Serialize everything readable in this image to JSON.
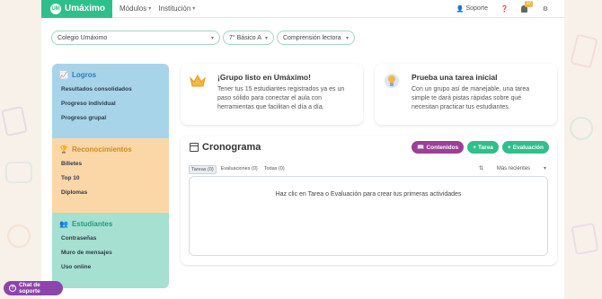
{
  "header": {
    "brand": "Umáximo",
    "brand_logo_text": "UM",
    "nav": [
      "Módulos",
      "Institución"
    ],
    "support": "Soporte",
    "notifications": "37"
  },
  "filters": {
    "school": "Colegio Umáximo",
    "grade": "7° Básico A",
    "subject": "Comprensión lectora"
  },
  "sidebar": {
    "sections": [
      {
        "title": "Logros",
        "icon": "chart-line-icon",
        "items": [
          "Resultados consolidados",
          "Progreso individual",
          "Progreso grupal"
        ]
      },
      {
        "title": "Reconocimientos",
        "icon": "trophy-icon",
        "items": [
          "Billetes",
          "Top 10",
          "Diplomas"
        ]
      },
      {
        "title": "Estudiantes",
        "icon": "users-icon",
        "items": [
          "Contraseñas",
          "Muro de mensajes",
          "Uso online"
        ]
      }
    ]
  },
  "cards": {
    "group_ready": {
      "title": "¡Grupo listo en Umáximo!",
      "text": "Tener tus 15 estudiantes registrados ya es un paso sólido para conectar el aula con herramientas que facilitan el día a día."
    },
    "first_task": {
      "title": "Prueba una tarea inicial",
      "text": "Con un grupo así de manejable, una tarea simple te dará pistas rápidas sobre qué necesitan practicar tus estudiantes."
    }
  },
  "cronograma": {
    "title": "Cronograma",
    "buttons": {
      "contents": "Contenidos",
      "task": "Tarea",
      "evaluation": "Evaluación"
    },
    "tabs": [
      "Tareas (0)",
      "Evaluaciones (0)",
      "Todas (0)"
    ],
    "sort": "Más recientes",
    "empty": "Haz clic en Tarea o Evaluación para crear tus primeras actividades"
  },
  "chat": {
    "label": "Chat de soporte"
  },
  "colors": {
    "brand": "#2fbf8a",
    "purple": "#9b3f97",
    "blue_section": "#a8d4ea",
    "orange_section": "#fbd7a7",
    "green_section": "#a6e0d1"
  }
}
